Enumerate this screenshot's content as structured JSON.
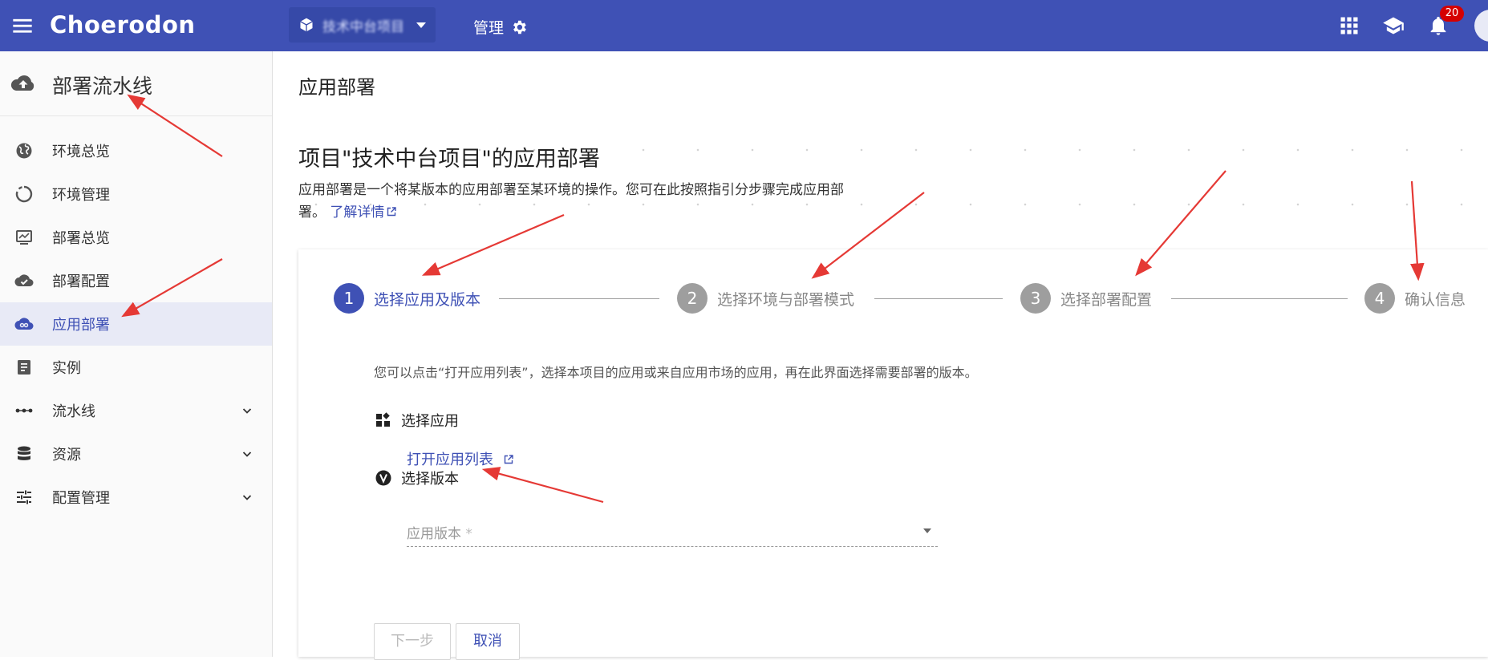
{
  "topbar": {
    "brand": "Choerodon",
    "project_name": "技术中台项目",
    "manage_label": "管理",
    "notification_count": "20"
  },
  "sidebar": {
    "header_title": "部署流水线",
    "items": [
      {
        "label": "环境总览",
        "icon": "globe-icon"
      },
      {
        "label": "环境管理",
        "icon": "ring-icon"
      },
      {
        "label": "部署总览",
        "icon": "monitor-icon"
      },
      {
        "label": "部署配置",
        "icon": "cloud-check-icon"
      },
      {
        "label": "应用部署",
        "icon": "cloud-link-icon",
        "active": true
      },
      {
        "label": "实例",
        "icon": "doc-icon"
      },
      {
        "label": "流水线",
        "icon": "dots-icon",
        "expandable": true
      },
      {
        "label": "资源",
        "icon": "database-icon",
        "expandable": true
      },
      {
        "label": "配置管理",
        "icon": "sliders-icon",
        "expandable": true
      }
    ]
  },
  "page": {
    "header_title": "应用部署",
    "headline": "项目\"技术中台项目\"的应用部署",
    "description": "应用部署是一个将某版本的应用部署至某环境的操作。您可在此按照指引分步骤完成应用部署。",
    "learn_more": "了解详情"
  },
  "steps": [
    {
      "num": "1",
      "label": "选择应用及版本",
      "active": true
    },
    {
      "num": "2",
      "label": "选择环境与部署模式"
    },
    {
      "num": "3",
      "label": "选择部署配置"
    },
    {
      "num": "4",
      "label": "确认信息"
    }
  ],
  "step1": {
    "hint": "您可以点击“打开应用列表”，选择本项目的应用或来自应用市场的应用，再在此界面选择需要部署的版本。",
    "select_app_title": "选择应用",
    "open_list_link": "打开应用列表",
    "select_version_title": "选择版本",
    "version_placeholder": "应用版本",
    "required_mark": "*",
    "next_button": "下一步",
    "cancel_button": "取消"
  },
  "colors": {
    "primary": "#3f51b5",
    "annotation_arrow": "#e53935"
  }
}
